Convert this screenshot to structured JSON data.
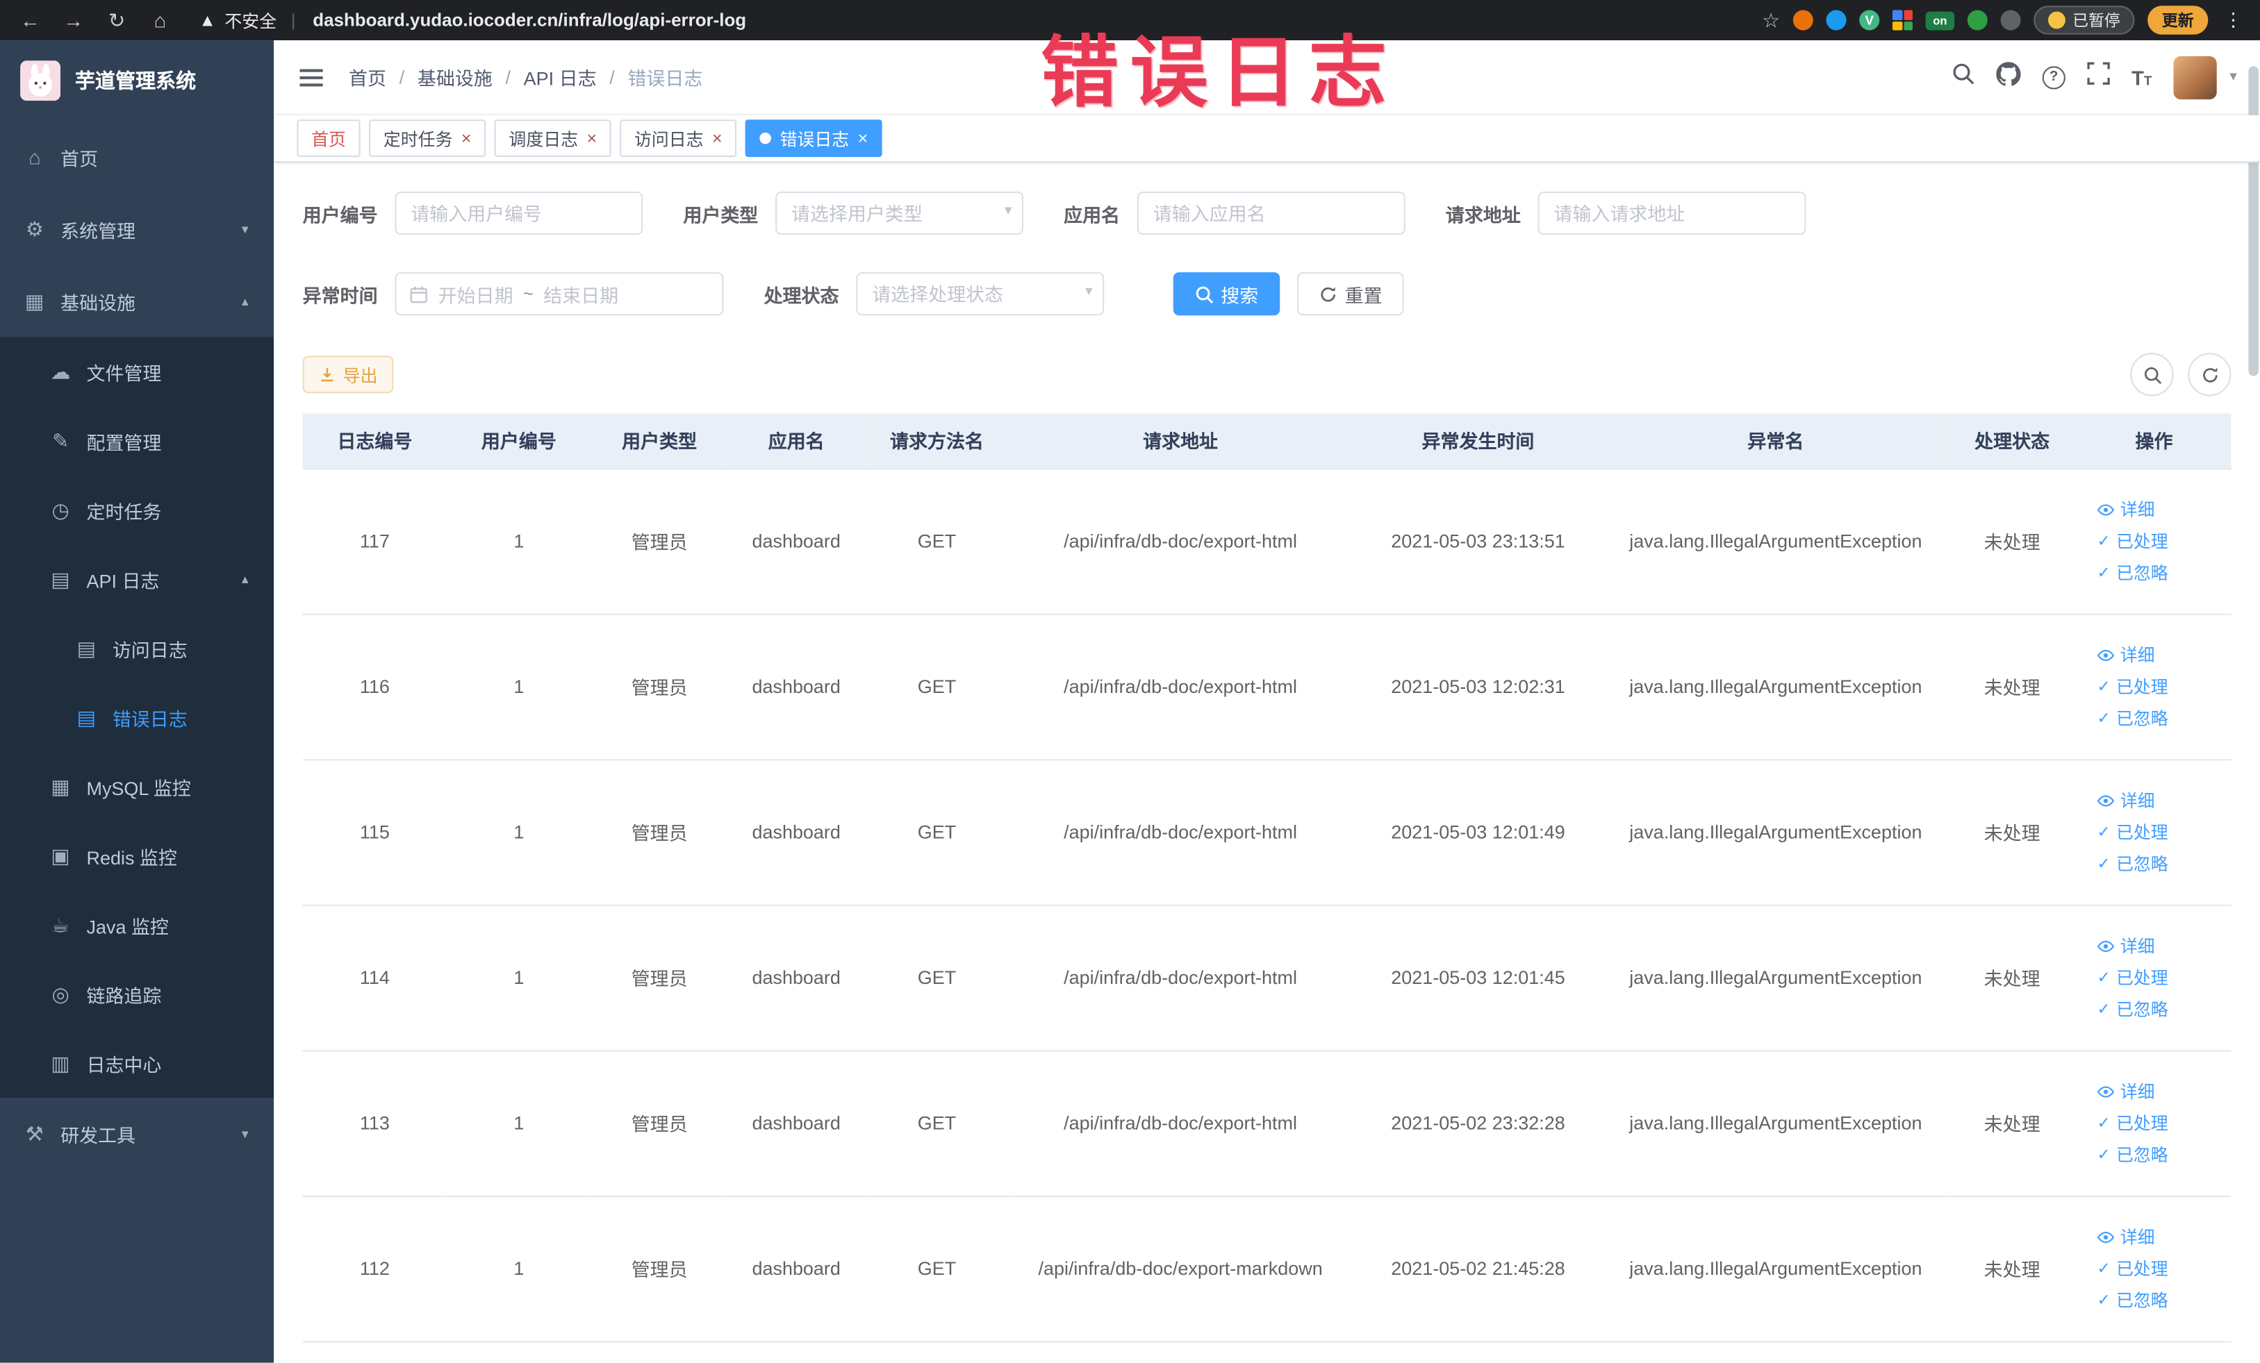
{
  "colors": {
    "accent": "#409eff",
    "warning": "#e6a23c",
    "annotation_red": "#ea3b56",
    "sidebar_bg": "#304156",
    "submenu_bg": "#1f2d3d",
    "chrome_bg": "#202124",
    "table_header_bg": "#e9eff7"
  },
  "browser": {
    "security_label": "不安全",
    "url": "dashboard.yudao.iocoder.cn/infra/log/api-error-log",
    "paused_label": "已暂停",
    "update_label": "更新"
  },
  "annotation": {
    "text": "错误日志"
  },
  "sidebar": {
    "logo_title": "芋道管理系统",
    "items": [
      {
        "label": "首页"
      },
      {
        "label": "系统管理"
      },
      {
        "label": "基础设施"
      },
      {
        "label": "文件管理"
      },
      {
        "label": "配置管理"
      },
      {
        "label": "定时任务"
      },
      {
        "label": "API 日志"
      },
      {
        "label": "访问日志"
      },
      {
        "label": "错误日志"
      },
      {
        "label": "MySQL 监控"
      },
      {
        "label": "Redis 监控"
      },
      {
        "label": "Java 监控"
      },
      {
        "label": "链路追踪"
      },
      {
        "label": "日志中心"
      },
      {
        "label": "研发工具"
      }
    ]
  },
  "breadcrumb": {
    "items": [
      "首页",
      "基础设施",
      "API 日志",
      "错误日志"
    ]
  },
  "tabs": {
    "items": [
      {
        "label": "首页"
      },
      {
        "label": "定时任务"
      },
      {
        "label": "调度日志"
      },
      {
        "label": "访问日志"
      },
      {
        "label": "错误日志"
      }
    ]
  },
  "filter": {
    "user_id": {
      "label": "用户编号",
      "placeholder": "请输入用户编号"
    },
    "user_type": {
      "label": "用户类型",
      "placeholder": "请选择用户类型"
    },
    "app_name": {
      "label": "应用名",
      "placeholder": "请输入应用名"
    },
    "request_url": {
      "label": "请求地址",
      "placeholder": "请输入请求地址"
    },
    "exception_time": {
      "label": "异常时间",
      "start_placeholder": "开始日期",
      "separator": "~",
      "end_placeholder": "结束日期"
    },
    "process_status": {
      "label": "处理状态",
      "placeholder": "请选择处理状态"
    },
    "search_label": "搜索",
    "reset_label": "重置"
  },
  "toolbar": {
    "export_label": "导出"
  },
  "table": {
    "headers": [
      "日志编号",
      "用户编号",
      "用户类型",
      "应用名",
      "请求方法名",
      "请求地址",
      "异常发生时间",
      "异常名",
      "处理状态",
      "操作"
    ],
    "actions": [
      "详细",
      "已处理",
      "已忽略"
    ],
    "rows": [
      [
        "117",
        "1",
        "管理员",
        "dashboard",
        "GET",
        "/api/infra/db-doc/export-html",
        "2021-05-03 23:13:51",
        "java.lang.IllegalArgumentException",
        "未处理"
      ],
      [
        "116",
        "1",
        "管理员",
        "dashboard",
        "GET",
        "/api/infra/db-doc/export-html",
        "2021-05-03 12:02:31",
        "java.lang.IllegalArgumentException",
        "未处理"
      ],
      [
        "115",
        "1",
        "管理员",
        "dashboard",
        "GET",
        "/api/infra/db-doc/export-html",
        "2021-05-03 12:01:49",
        "java.lang.IllegalArgumentException",
        "未处理"
      ],
      [
        "114",
        "1",
        "管理员",
        "dashboard",
        "GET",
        "/api/infra/db-doc/export-html",
        "2021-05-03 12:01:45",
        "java.lang.IllegalArgumentException",
        "未处理"
      ],
      [
        "113",
        "1",
        "管理员",
        "dashboard",
        "GET",
        "/api/infra/db-doc/export-html",
        "2021-05-02 23:32:28",
        "java.lang.IllegalArgumentException",
        "未处理"
      ],
      [
        "112",
        "1",
        "管理员",
        "dashboard",
        "GET",
        "/api/infra/db-doc/export-markdown",
        "2021-05-02 21:45:28",
        "java.lang.IllegalArgumentException",
        "未处理"
      ]
    ]
  }
}
